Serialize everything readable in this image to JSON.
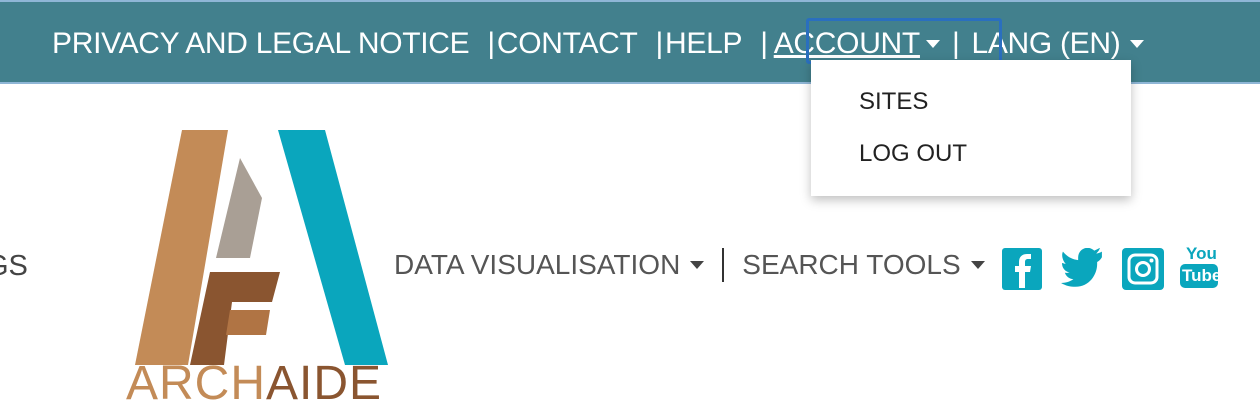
{
  "topbar": {
    "items": [
      {
        "label": "PRIVACY AND LEGAL NOTICE"
      },
      {
        "label": "CONTACT"
      },
      {
        "label": "HELP"
      },
      {
        "label": "ACCOUNT"
      },
      {
        "label": "LANG (EN)"
      }
    ],
    "separator": "|"
  },
  "account_menu": {
    "items": [
      {
        "label": "SITES"
      },
      {
        "label": "LOG OUT"
      }
    ]
  },
  "left_edge_text": "GS",
  "logo": {
    "text_arch": "ARCH",
    "text_aide": "AIDE"
  },
  "mainnav": {
    "items": [
      {
        "label": "DATA VISUALISATION"
      },
      {
        "label": "SEARCH TOOLS"
      }
    ]
  },
  "social": {
    "icons": [
      "facebook-icon",
      "twitter-icon",
      "instagram-icon",
      "youtube-icon"
    ],
    "youtube_top": "You",
    "youtube_bottom": "Tube"
  },
  "colors": {
    "topbar": "#42808d",
    "brand_teal": "#0aa6bd",
    "brand_brown": "#c38b57",
    "brand_dark_brown": "#8a5530",
    "brand_grey": "#a99f95"
  }
}
